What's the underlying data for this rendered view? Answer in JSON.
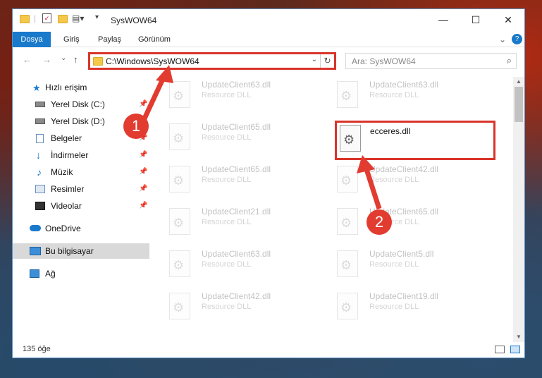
{
  "window": {
    "title": "SysWOW64",
    "controls": {
      "minimize": "—",
      "maximize": "☐",
      "close": "✕"
    }
  },
  "ribbon": {
    "tabs": [
      "Dosya",
      "Giriş",
      "Paylaş",
      "Görünüm"
    ],
    "expand_glyph": "⌄",
    "help_glyph": "?"
  },
  "nav": {
    "back": "←",
    "forward": "→",
    "recent": "⌄",
    "up": "↑",
    "address": "C:\\Windows\\SysWOW64",
    "search_placeholder": "Ara: SysWOW64"
  },
  "sidebar": {
    "items": [
      {
        "label": "Hızlı erişim",
        "icon": "star-icon"
      },
      {
        "label": "Yerel Disk (C:)",
        "icon": "drive-icon",
        "pinned": true
      },
      {
        "label": "Yerel Disk (D:)",
        "icon": "drive-icon",
        "pinned": true
      },
      {
        "label": "Belgeler",
        "icon": "documents-icon",
        "pinned": true
      },
      {
        "label": "İndirmeler",
        "icon": "download-icon",
        "pinned": true
      },
      {
        "label": "Müzik",
        "icon": "music-icon",
        "pinned": true
      },
      {
        "label": "Resimler",
        "icon": "pictures-icon",
        "pinned": true
      },
      {
        "label": "Videolar",
        "icon": "videos-icon",
        "pinned": true
      },
      {
        "label": "OneDrive",
        "icon": "onedrive-icon"
      },
      {
        "label": "Bu bilgisayar",
        "icon": "computer-icon",
        "selected": true
      },
      {
        "label": "Ağ",
        "icon": "network-icon"
      }
    ]
  },
  "files": [
    {
      "name": "UpdateClient63.dll",
      "type": "Resource DLL"
    },
    {
      "name": "UpdateClient63.dll",
      "type": "Resource DLL"
    },
    {
      "name": "UpdateClient65.dll",
      "type": "Resource DLL"
    },
    {
      "name": "ecceres.dll",
      "type": "",
      "highlighted": true
    },
    {
      "name": "UpdateClient65.dll",
      "type": "Resource DLL"
    },
    {
      "name": "UpdateClient42.dll",
      "type": "Resource DLL"
    },
    {
      "name": "UpdateClient21.dll",
      "type": "Resource DLL"
    },
    {
      "name": "UpdateClient65.dll",
      "type": "Resource DLL"
    },
    {
      "name": "UpdateClient63.dll",
      "type": "Resource DLL"
    },
    {
      "name": "UpdateClient5.dll",
      "type": "Resource DLL"
    },
    {
      "name": "UpdateClient42.dll",
      "type": "Resource DLL"
    },
    {
      "name": "UpdateClient19.dll",
      "type": "Resource DLL"
    }
  ],
  "status": {
    "count": "135 öğe"
  },
  "annotations": {
    "step1": "1",
    "step2": "2",
    "color": "#e23b30"
  }
}
